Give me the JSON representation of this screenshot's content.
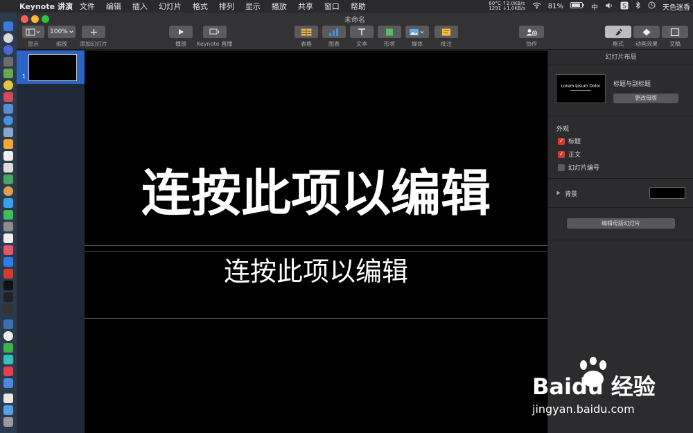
{
  "menubar": {
    "app_name": "Keynote 讲演",
    "items": [
      "文件",
      "编辑",
      "插入",
      "幻灯片",
      "格式",
      "排列",
      "显示",
      "播放",
      "共享",
      "窗口",
      "帮助"
    ],
    "status": {
      "temp": "60°C",
      "fan": "1291",
      "net_up": "↑2.0KB/s",
      "net_down": "↓1.0KB/s",
      "battery": "81%",
      "input_method": "中",
      "user": "天色迷香"
    }
  },
  "window": {
    "title": "未命名"
  },
  "toolbar": {
    "view_label": "显示",
    "zoom_value": "100%",
    "zoom_label": "缩放",
    "add_slide_label": "添加幻灯片",
    "play_label": "播放",
    "keynote_live_label": "Keynote 直播",
    "table_label": "表格",
    "chart_label": "图表",
    "text_label": "文本",
    "shape_label": "形状",
    "media_label": "媒体",
    "comment_label": "批注",
    "collaborate_label": "协作",
    "format_label": "格式",
    "animate_label": "动画效果",
    "document_label": "文稿"
  },
  "navigator": {
    "slide_number": "1"
  },
  "slide": {
    "title": "连按此项以编辑",
    "subtitle": "连按此项以编辑"
  },
  "inspector": {
    "header": "幻灯片布局",
    "layout_thumb_text": "Lorem Ipsum Dolor",
    "layout_name": "标题与副标题",
    "change_master": "更改母版",
    "appearance": "外观",
    "checkboxes": [
      {
        "label": "标题",
        "checked": true
      },
      {
        "label": "正文",
        "checked": true
      },
      {
        "label": "幻灯片编号",
        "checked": false
      }
    ],
    "background_label": "背景",
    "edit_master": "编辑母版幻灯片"
  },
  "watermark": {
    "brand": "Baidu 经验",
    "url": "jingyan.baidu.com"
  },
  "colors": {
    "accent": "#2b63c7",
    "checkbox_on": "#d33b30",
    "dock": "#2b3a4d"
  }
}
